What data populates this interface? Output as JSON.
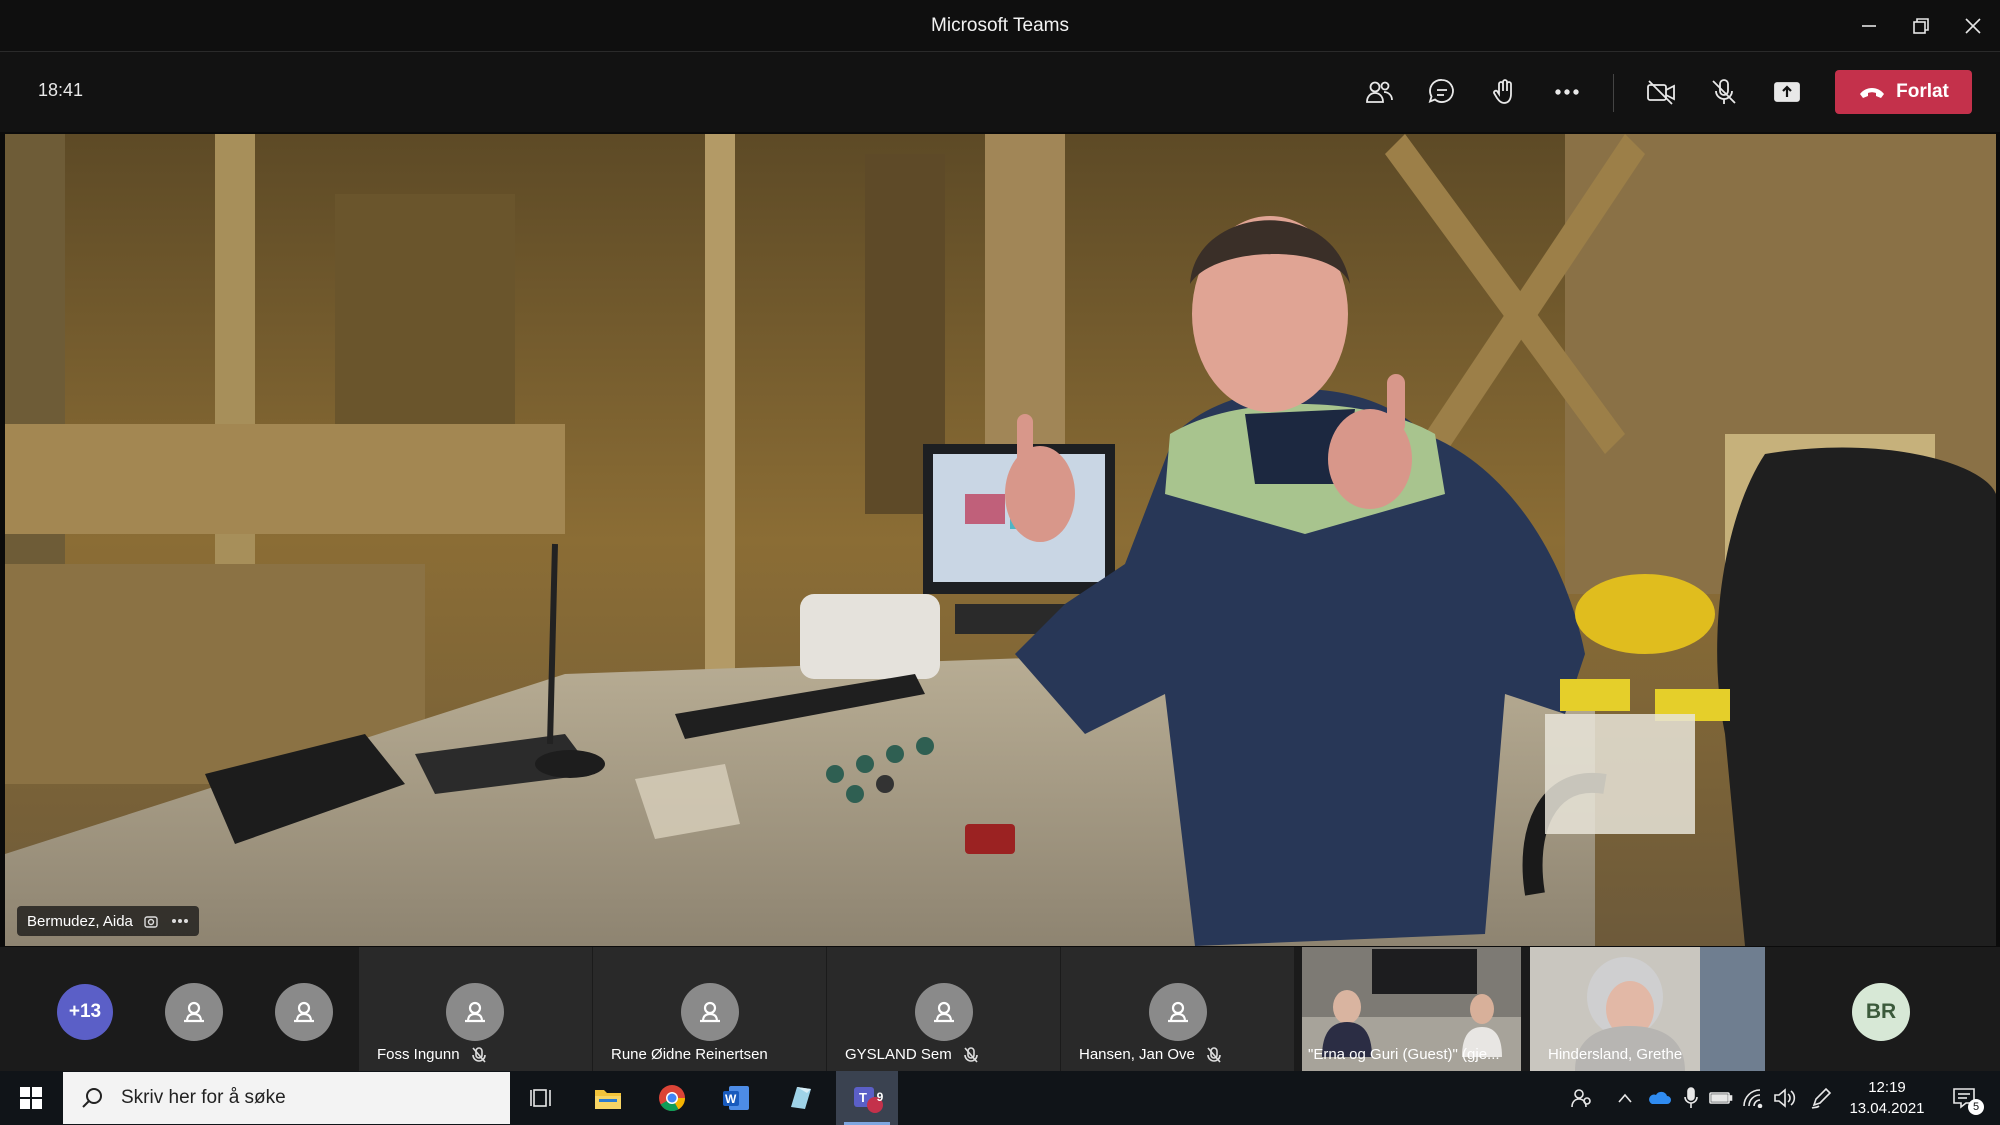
{
  "window": {
    "title": "Microsoft Teams"
  },
  "meeting": {
    "elapsed_time": "18:41",
    "leave_label": "Forlat",
    "active_speaker": "Bermudez, Aida"
  },
  "participants": {
    "overflow_count": "+13",
    "tiles": [
      {
        "name": "Foss Ingunn",
        "muted": true
      },
      {
        "name": "Rune Øidne Reinertsen",
        "muted": false
      },
      {
        "name": "GYSLAND Sem",
        "muted": true
      },
      {
        "name": "Hansen, Jan Ove",
        "muted": true
      },
      {
        "name": "\"Erna og Guri (Guest)\" (gje...",
        "muted": false
      },
      {
        "name": "Hindersland, Grethe",
        "muted": false
      }
    ],
    "initials_avatar": "BR"
  },
  "taskbar": {
    "search_placeholder": "Skriv her for å søke",
    "teams_badge": "9",
    "clock_time": "12:19",
    "clock_date": "13.04.2021",
    "notification_count": "5"
  },
  "colors": {
    "accent": "#5b5fc7",
    "leave": "#c4314b"
  }
}
